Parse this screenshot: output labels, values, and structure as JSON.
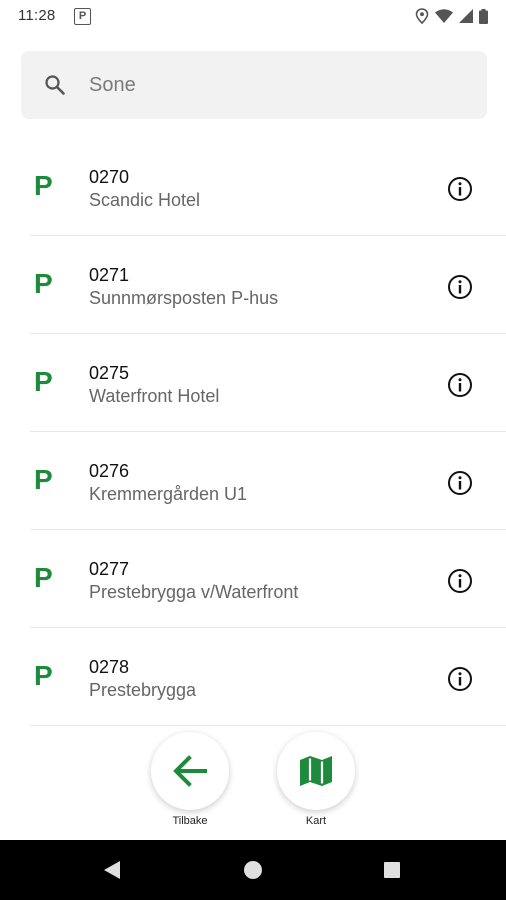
{
  "status_bar": {
    "time": "11:28",
    "parking_notification": "P"
  },
  "search": {
    "placeholder": "Sone",
    "value": ""
  },
  "zones": [
    {
      "code": "0270",
      "name": "Scandic Hotel"
    },
    {
      "code": "0271",
      "name": "Sunnmørsposten P-hus"
    },
    {
      "code": "0275",
      "name": "Waterfront Hotel"
    },
    {
      "code": "0276",
      "name": "Kremmergården U1"
    },
    {
      "code": "0277",
      "name": "Prestebrygga v/Waterfront"
    },
    {
      "code": "0278",
      "name": "Prestebrygga"
    }
  ],
  "parking_symbol": "P",
  "actions": {
    "back_label": "Tilbake",
    "map_label": "Kart"
  },
  "colors": {
    "accent_green": "#1e8a3c",
    "search_bg": "#f2f2f2",
    "nav_bar": "#000000"
  },
  "icons": {
    "search": "search-icon",
    "info": "info-icon",
    "back": "arrow-left-icon",
    "map": "map-icon"
  }
}
